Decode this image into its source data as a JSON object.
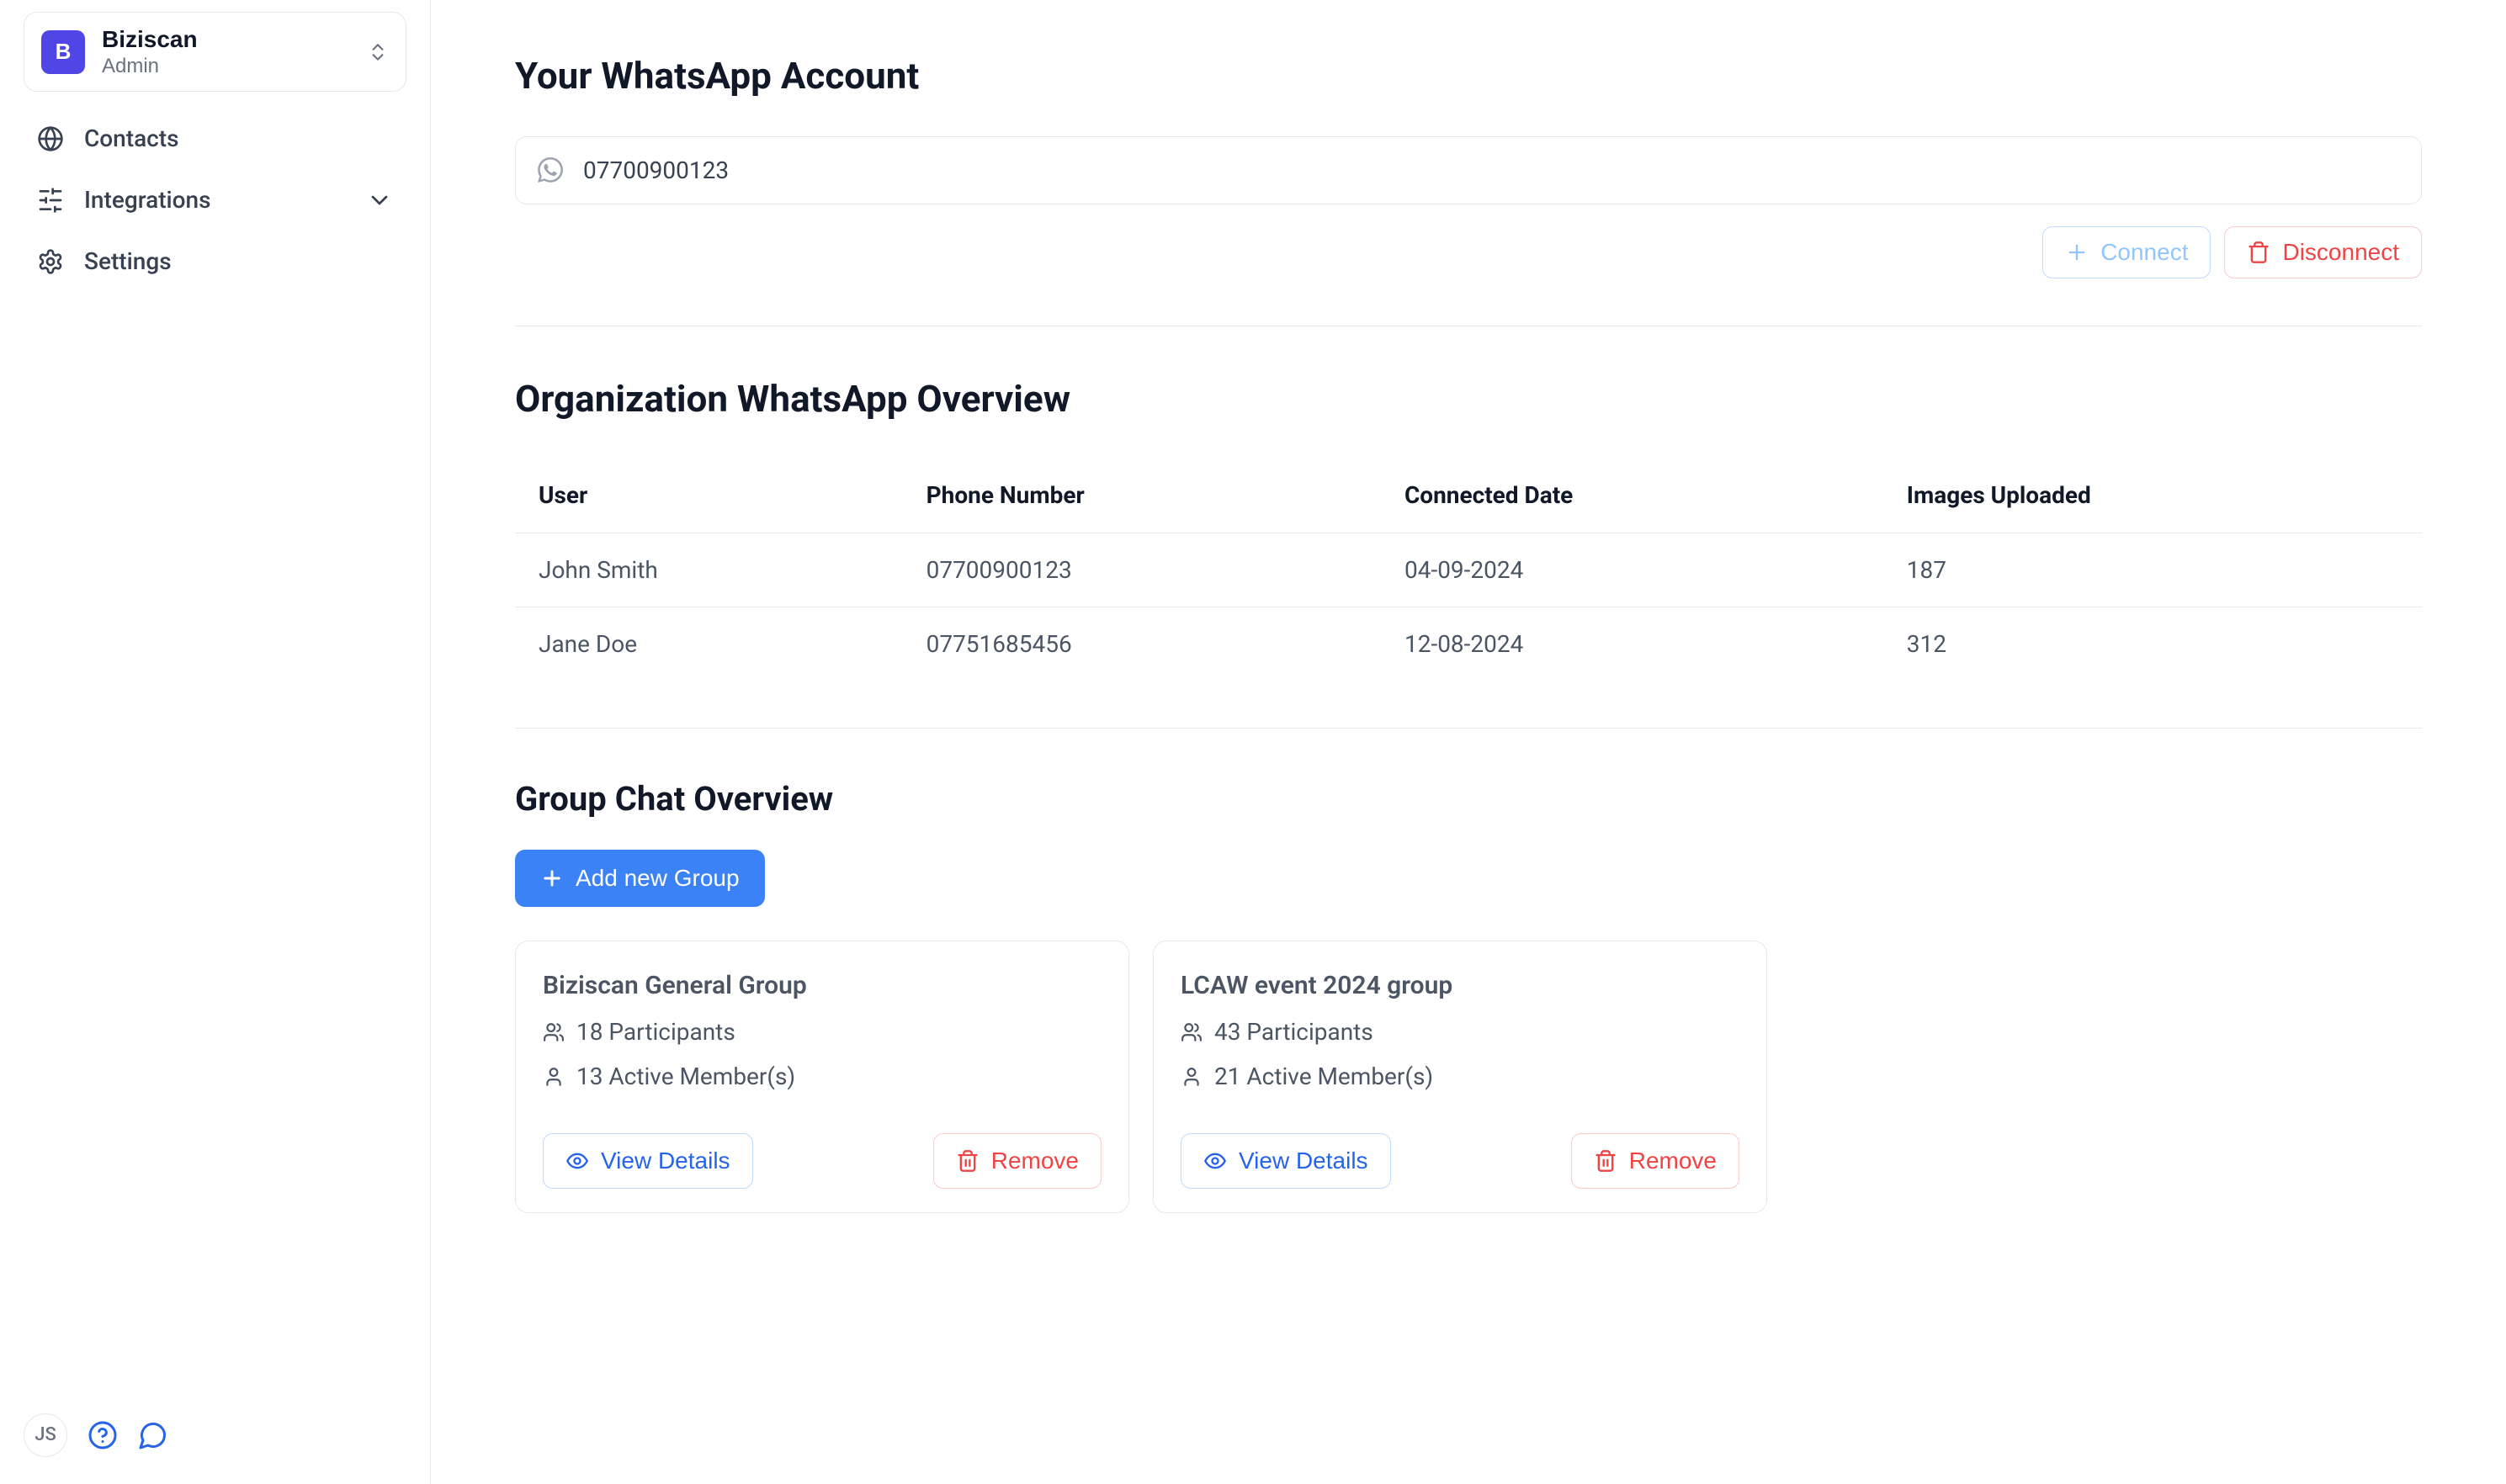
{
  "sidebar": {
    "org": {
      "initial": "B",
      "name": "Biziscan",
      "role": "Admin"
    },
    "nav": {
      "contacts": "Contacts",
      "integrations": "Integrations",
      "settings": "Settings"
    },
    "footer": {
      "avatar": "JS"
    }
  },
  "account": {
    "title": "Your WhatsApp Account",
    "phone": "07700900123",
    "connect_label": "Connect",
    "disconnect_label": "Disconnect"
  },
  "overview": {
    "title": "Organization WhatsApp Overview",
    "columns": {
      "user": "User",
      "phone": "Phone Number",
      "connected": "Connected Date",
      "images": "Images Uploaded"
    },
    "rows": [
      {
        "user": "John Smith",
        "phone": "07700900123",
        "connected": "04-09-2024",
        "images": "187"
      },
      {
        "user": "Jane Doe",
        "phone": "07751685456",
        "connected": "12-08-2024",
        "images": "312"
      }
    ]
  },
  "groups": {
    "title": "Group Chat Overview",
    "add_label": "Add new Group",
    "view_label": "View Details",
    "remove_label": "Remove",
    "items": [
      {
        "name": "Biziscan General Group",
        "participants": "18 Participants",
        "active": "13 Active Member(s)"
      },
      {
        "name": "LCAW event 2024 group",
        "participants": "43 Participants",
        "active": "21 Active Member(s)"
      }
    ]
  }
}
